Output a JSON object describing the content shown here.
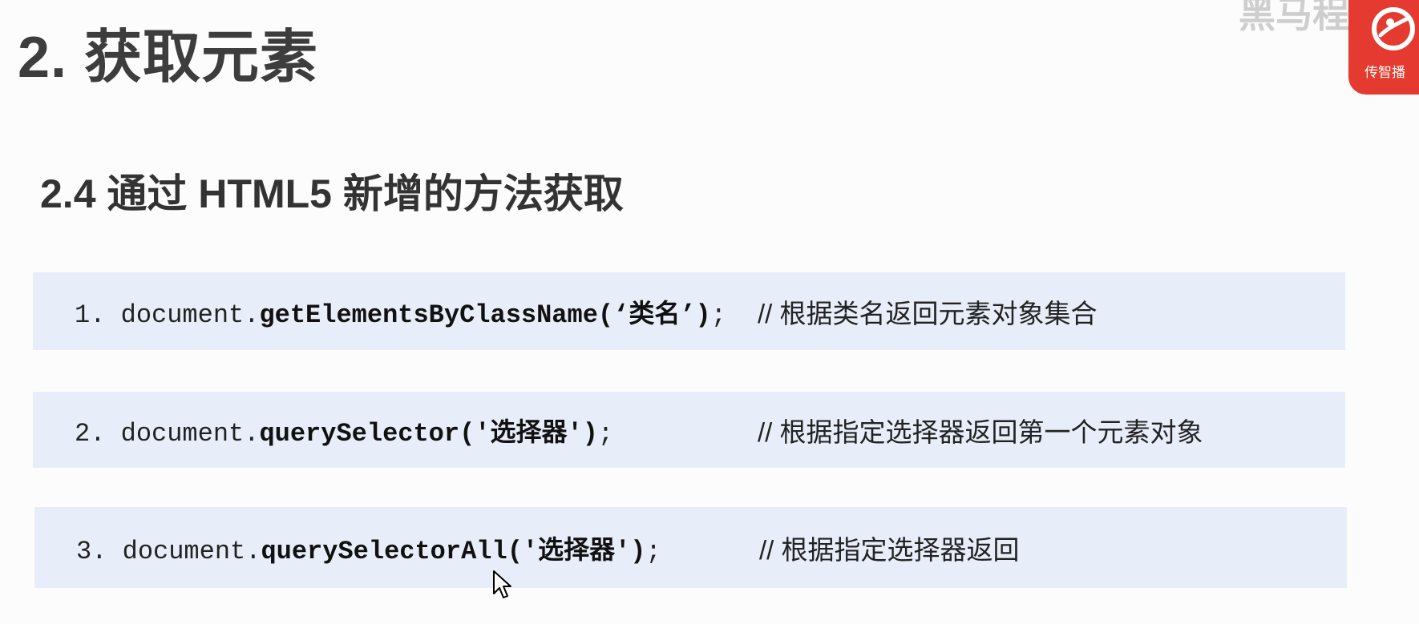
{
  "title": "2. 获取元素",
  "subtitle": "2.4 通过 HTML5 新增的方法获取",
  "watermark": "黑马程序",
  "logo": {
    "text": "传智播",
    "icon": "brand-logo-icon"
  },
  "colors": {
    "code_box_bg": "#e8eef9",
    "logo_bg": "#e53a2f",
    "title": "#3d3d3d"
  },
  "code_lines": [
    {
      "number": "1.",
      "object": "document.",
      "method": "getElementsByClassName",
      "args": "(‘类名’)",
      "end": ";",
      "comment": "// 根据类名返回元素对象集合"
    },
    {
      "number": "2.",
      "object": "document.",
      "method": "querySelector",
      "args": "('选择器')",
      "end": ";",
      "comment": "// 根据指定选择器返回第一个元素对象"
    },
    {
      "number": "3.",
      "object": "document.",
      "method": "querySelectorAll",
      "args": "('选择器')",
      "end": ";",
      "comment": "// 根据指定选择器返回"
    }
  ],
  "cursor": {
    "icon": "mouse-pointer-icon"
  }
}
